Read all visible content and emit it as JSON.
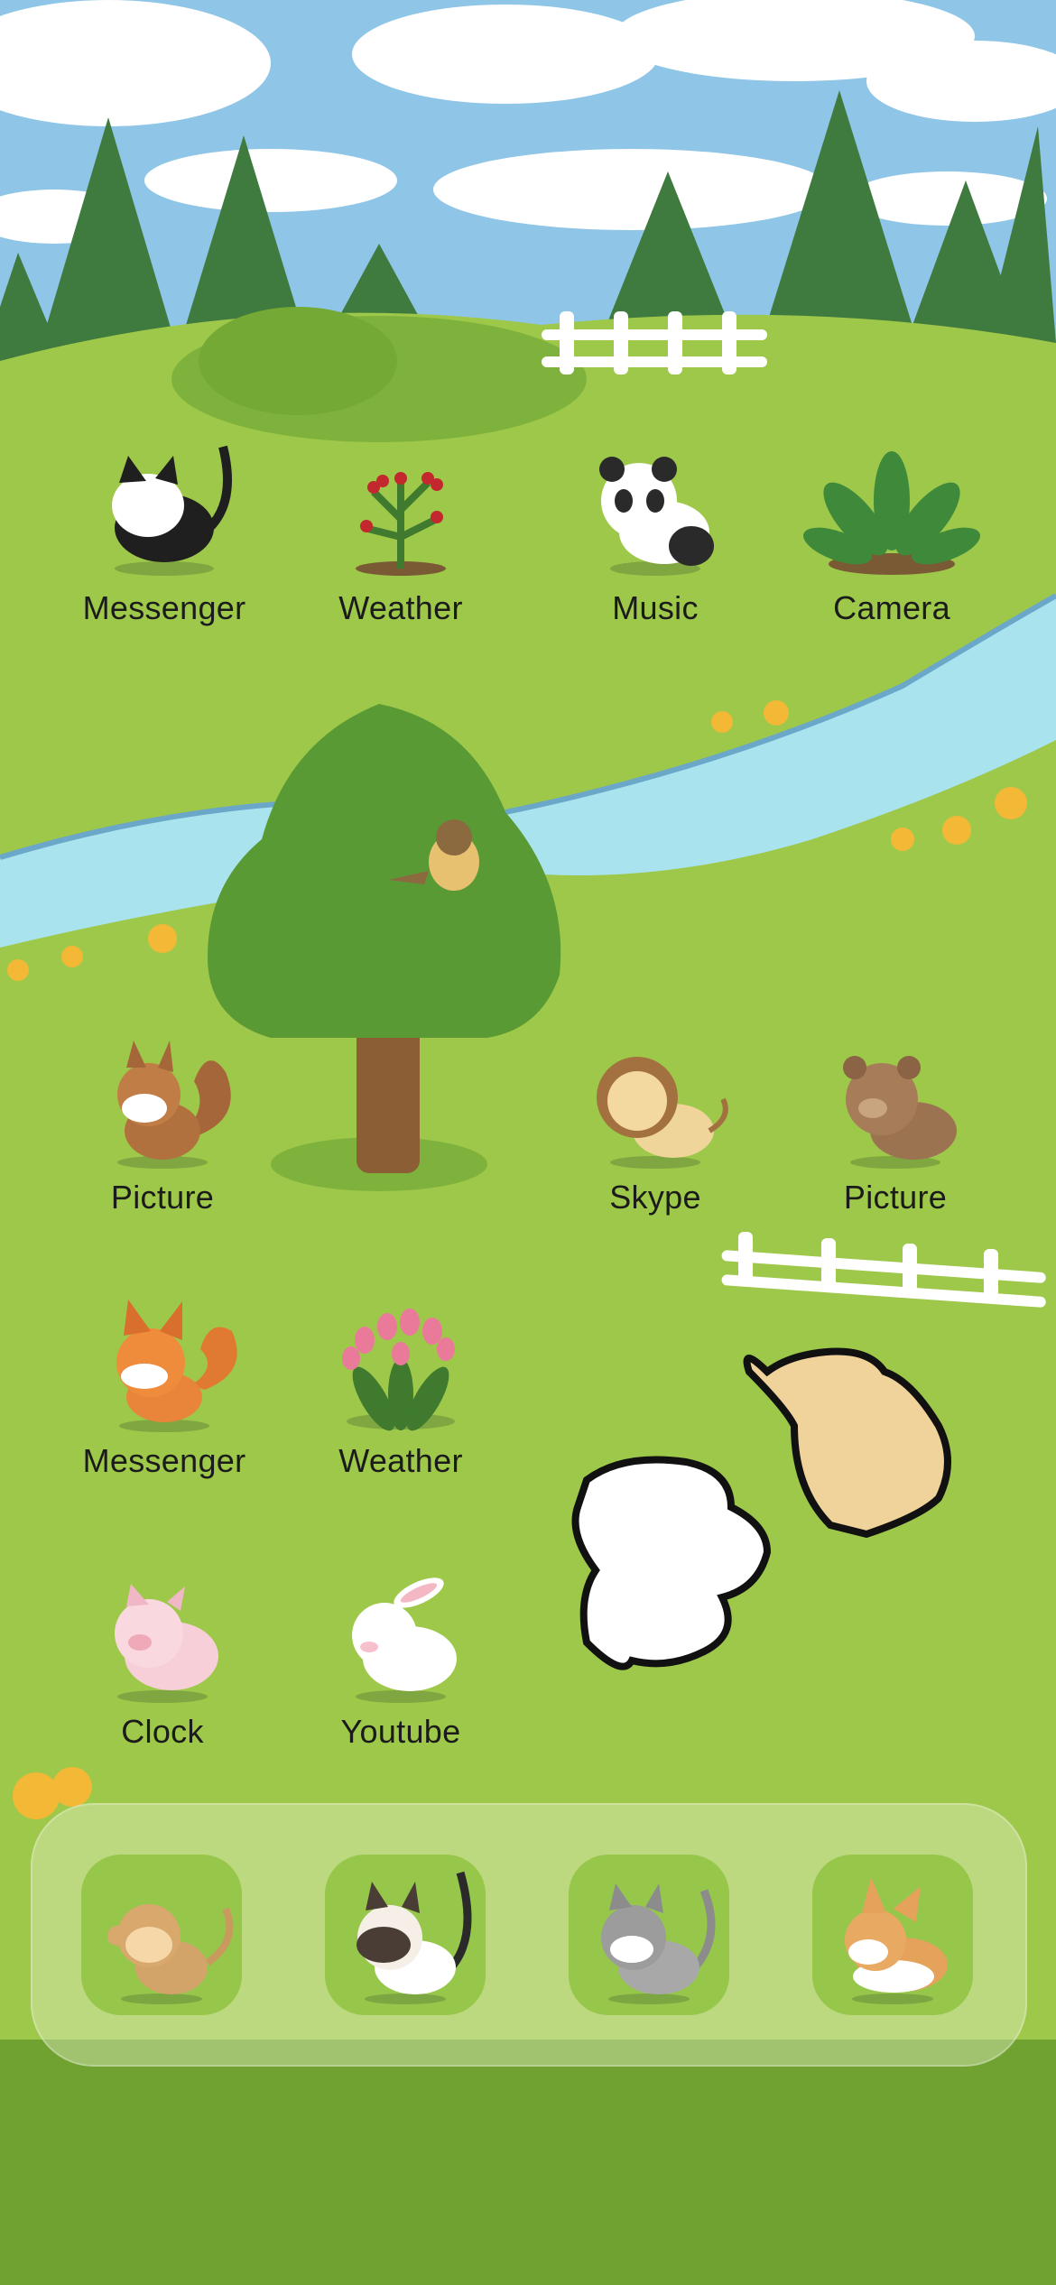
{
  "home_screen": {
    "apps": [
      {
        "label": "Messenger",
        "icon": "black-white-cat-icon"
      },
      {
        "label": "Weather",
        "icon": "berry-bush-icon"
      },
      {
        "label": "Music",
        "icon": "panda-icon"
      },
      {
        "label": "Camera",
        "icon": "hosta-plant-icon"
      },
      {
        "label": "Picture",
        "icon": "squirrel-icon"
      },
      {
        "label": "Skype",
        "icon": "lion-icon"
      },
      {
        "label": "Picture",
        "icon": "brown-bear-icon"
      },
      {
        "label": "Messenger",
        "icon": "fox-icon"
      },
      {
        "label": "Weather",
        "icon": "tulip-plant-icon"
      },
      {
        "label": "Clock",
        "icon": "pig-icon"
      },
      {
        "label": "Youtube",
        "icon": "bunny-icon"
      }
    ],
    "dock": [
      {
        "icon": "monkey-icon"
      },
      {
        "icon": "siamese-cat-icon"
      },
      {
        "icon": "tabby-cat-icon"
      },
      {
        "icon": "corgi-icon"
      }
    ]
  },
  "colors": {
    "sky": "#8fc6e8",
    "grass": "#9ec84a",
    "dark_grass": "#6fa230",
    "river": "#a9e4ee",
    "tree": "#4f8f2e",
    "label_text": "#1b1b1b"
  }
}
